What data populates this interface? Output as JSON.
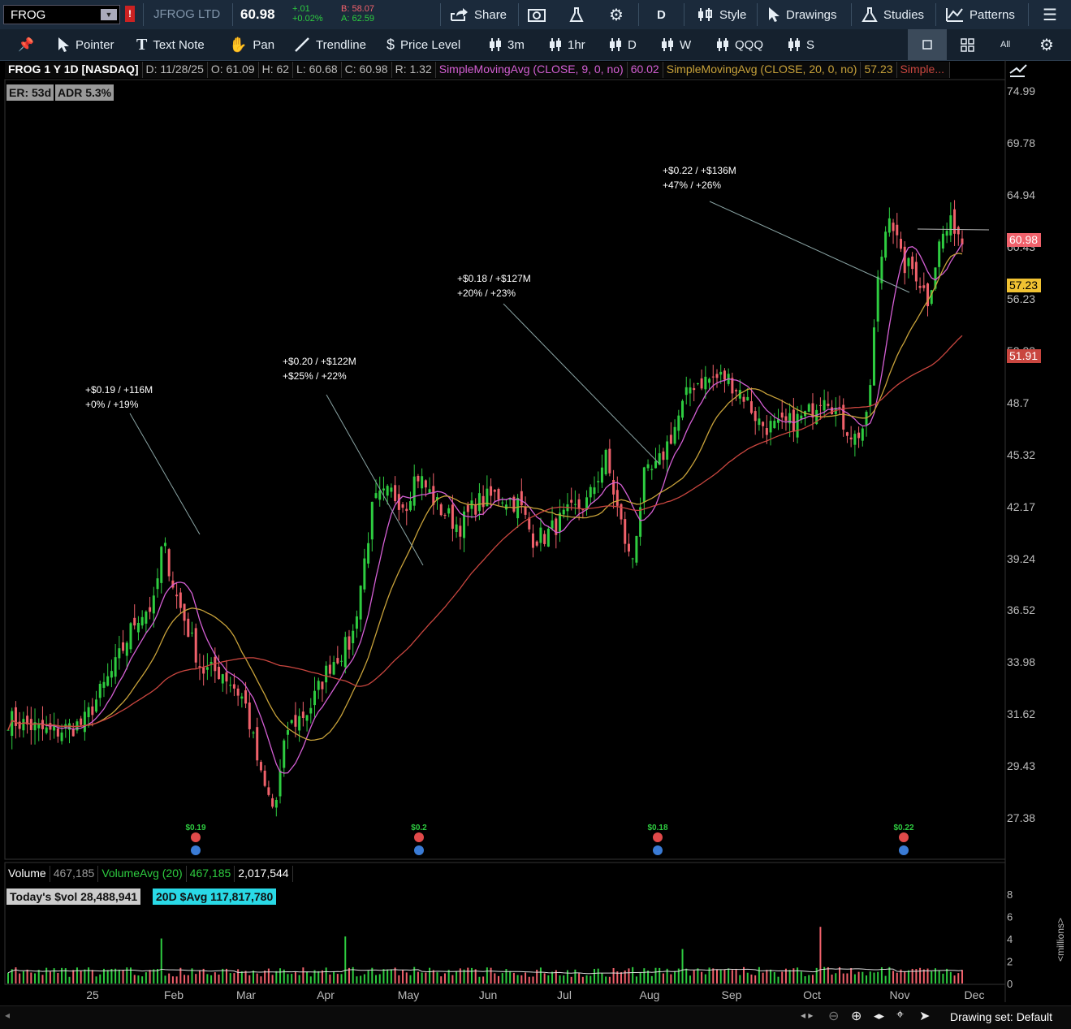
{
  "topbar": {
    "symbol": "FROG",
    "alert_flag": "!",
    "company": "JFROG LTD",
    "last": "60.98",
    "change": "+.01",
    "change_pct": "+0.02%",
    "bid": "B: 58.07",
    "ask": "A: 62.59",
    "share_label": "Share",
    "period_label": "D",
    "style_label": "Style",
    "drawings_label": "Drawings",
    "studies_label": "Studies",
    "patterns_label": "Patterns"
  },
  "toolbar": {
    "pointer": "Pointer",
    "text_note": "Text Note",
    "pan": "Pan",
    "trendline": "Trendline",
    "price_level": "Price Level",
    "p3m": "3m",
    "p1hr": "1hr",
    "pD": "D",
    "pW": "W",
    "qqq": "QQQ",
    "s": "S",
    "all": "All"
  },
  "header": {
    "title": "FROG 1 Y 1D [NASDAQ]",
    "date": "D: 11/28/25",
    "open": "O: 61.09",
    "high": "H: 62",
    "low": "L: 60.68",
    "close": "C: 60.98",
    "range": "R: 1.32",
    "sma9_label": "SimpleMovingAvg (CLOSE, 9, 0, no)",
    "sma9_value": "60.02",
    "sma20_label": "SimpleMovingAvg (CLOSE, 20, 0, no)",
    "sma20_value": "57.23",
    "sma50_label": "Simple..."
  },
  "badges": {
    "er": "ER: 53d",
    "adr": "ADR 5.3%"
  },
  "price_axis": [
    "74.99",
    "69.78",
    "64.94",
    "60.43",
    "56.23",
    "52.33",
    "48.7",
    "45.32",
    "42.17",
    "39.24",
    "36.52",
    "33.98",
    "31.62",
    "29.43",
    "27.38"
  ],
  "price_tags": {
    "last": "60.98",
    "sma20": "57.23",
    "sma50": "51.91"
  },
  "annotations": [
    {
      "line1": "+$0.19 / +116M",
      "line2": "+0% / +19%"
    },
    {
      "line1": "+$0.20 / +$122M",
      "line2": "+$25% / +22%"
    },
    {
      "line1": "+$0.18 / +$127M",
      "line2": "+20% / +23%"
    },
    {
      "line1": "+$0.22 / +$136M",
      "line2": "+47% / +26%"
    }
  ],
  "earnings": [
    "$0.19",
    "$0.2",
    "$0.18",
    "$0.22"
  ],
  "volume": {
    "label": "Volume",
    "value": "467,185",
    "avg_label": "VolumeAvg (20)",
    "avg_value": "467,185",
    "avg2": "2,017,544",
    "today_dollar": "Today's $vol 28,488,941",
    "avg_dollar": "20D $Avg 117,817,780",
    "axis": [
      "8",
      "6",
      "4",
      "2",
      "0"
    ],
    "unit": "<millions>"
  },
  "time_axis": [
    "25",
    "Feb",
    "Mar",
    "Apr",
    "May",
    "Jun",
    "Jul",
    "Aug",
    "Sep",
    "Oct",
    "Nov",
    "Dec"
  ],
  "bottom": {
    "drawing_set": "Drawing set: Default"
  },
  "colors": {
    "up": "#2ecc40",
    "down": "#f0616b",
    "sma9": "#d45fd4",
    "sma20": "#c8a23a",
    "sma50": "#c9463f",
    "bg": "#000000"
  }
}
